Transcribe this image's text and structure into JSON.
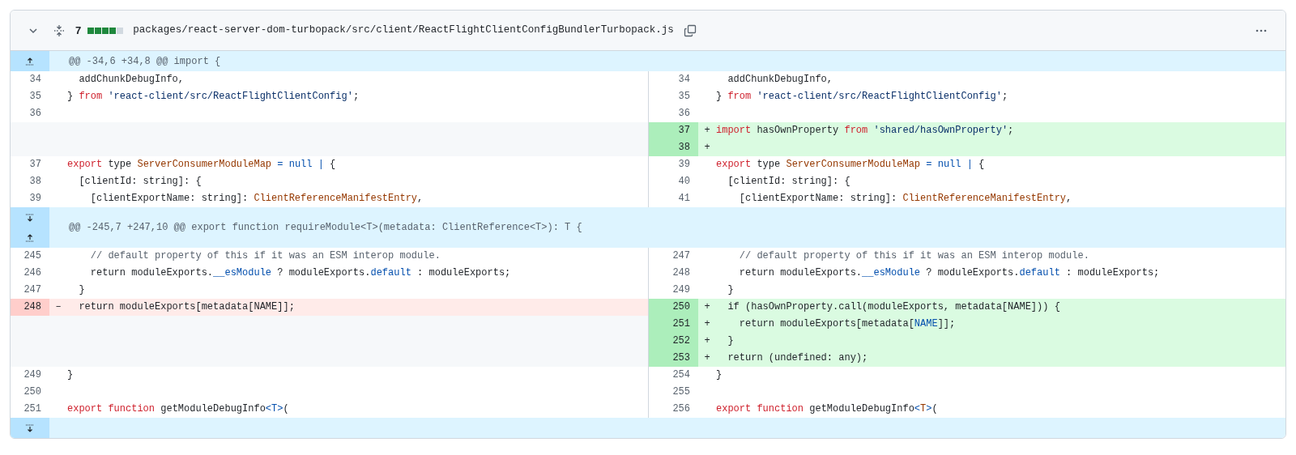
{
  "header": {
    "expanded": true,
    "change_count": "7",
    "diffstat": [
      {
        "kind": "added"
      },
      {
        "kind": "added"
      },
      {
        "kind": "added"
      },
      {
        "kind": "added"
      },
      {
        "kind": "neutral"
      }
    ],
    "path": "packages/react-server-dom-turbopack/src/client/ReactFlightClientConfigBundlerTurbopack.js"
  },
  "rows": [
    {
      "kind": "hunk",
      "expand": [
        {
          "kind": "up"
        }
      ],
      "text": "@@ -34,6 +34,8 @@ import {"
    },
    {
      "kind": "line",
      "left": {
        "num": "34",
        "kind": "context",
        "tokens": [
          {
            "t": "  addChunkDebugInfo,",
            "kind": "plain"
          }
        ]
      },
      "right": {
        "num": "34",
        "kind": "context",
        "tokens": [
          {
            "t": "  addChunkDebugInfo,",
            "kind": "plain"
          }
        ]
      }
    },
    {
      "kind": "line",
      "left": {
        "num": "35",
        "kind": "context",
        "tokens": [
          {
            "t": "} ",
            "kind": "plain"
          },
          {
            "t": "from",
            "kind": "keyword"
          },
          {
            "t": " 'react-client/src/ReactFlightClientConfig'",
            "kind": "string"
          },
          {
            "t": ";",
            "kind": "plain"
          }
        ]
      },
      "right": {
        "num": "35",
        "kind": "context",
        "tokens": [
          {
            "t": "} ",
            "kind": "plain"
          },
          {
            "t": "from",
            "kind": "keyword"
          },
          {
            "t": " 'react-client/src/ReactFlightClientConfig'",
            "kind": "string"
          },
          {
            "t": ";",
            "kind": "plain"
          }
        ]
      }
    },
    {
      "kind": "line",
      "left": {
        "num": "36",
        "kind": "context"
      },
      "right": {
        "num": "36",
        "kind": "context"
      }
    },
    {
      "kind": "line",
      "left": null,
      "right": {
        "num": "37",
        "kind": "add",
        "marker": "+",
        "tokens": [
          {
            "t": "import",
            "kind": "keyword"
          },
          {
            "t": " hasOwnProperty ",
            "kind": "plain"
          },
          {
            "t": "from",
            "kind": "keyword"
          },
          {
            "t": " 'shared/hasOwnProperty'",
            "kind": "string"
          },
          {
            "t": ";",
            "kind": "plain"
          }
        ]
      }
    },
    {
      "kind": "line",
      "left": null,
      "right": {
        "num": "38",
        "kind": "add",
        "marker": "+"
      }
    },
    {
      "kind": "line",
      "left": {
        "num": "37",
        "kind": "context",
        "tokens": [
          {
            "t": "export",
            "kind": "keyword"
          },
          {
            "t": " type ",
            "kind": "plain"
          },
          {
            "t": "ServerConsumerModuleMap",
            "kind": "entity"
          },
          {
            "t": " = null |",
            "kind": "constant"
          },
          {
            "t": " {",
            "kind": "plain"
          }
        ]
      },
      "right": {
        "num": "39",
        "kind": "context",
        "tokens": [
          {
            "t": "export",
            "kind": "keyword"
          },
          {
            "t": " type ",
            "kind": "plain"
          },
          {
            "t": "ServerConsumerModuleMap",
            "kind": "entity"
          },
          {
            "t": " = null |",
            "kind": "constant"
          },
          {
            "t": " {",
            "kind": "plain"
          }
        ]
      }
    },
    {
      "kind": "line",
      "left": {
        "num": "38",
        "kind": "context",
        "tokens": [
          {
            "t": "  [clientId: string]: {",
            "kind": "plain"
          }
        ]
      },
      "right": {
        "num": "40",
        "kind": "context",
        "tokens": [
          {
            "t": "  [clientId: string]: {",
            "kind": "plain"
          }
        ]
      }
    },
    {
      "kind": "line",
      "left": {
        "num": "39",
        "kind": "context",
        "tokens": [
          {
            "t": "    [clientExportName: string]: ",
            "kind": "plain"
          },
          {
            "t": "ClientReferenceManifestEntry",
            "kind": "entity"
          },
          {
            "t": ",",
            "kind": "plain"
          }
        ]
      },
      "right": {
        "num": "41",
        "kind": "context",
        "tokens": [
          {
            "t": "    [clientExportName: string]: ",
            "kind": "plain"
          },
          {
            "t": "ClientReferenceManifestEntry",
            "kind": "entity"
          },
          {
            "t": ",",
            "kind": "plain"
          }
        ]
      }
    },
    {
      "kind": "hunk",
      "expand": [
        {
          "kind": "down"
        },
        {
          "kind": "up"
        }
      ],
      "text": "@@ -245,7 +247,10 @@ export function requireModule<T>(metadata: ClientReference<T>): T {"
    },
    {
      "kind": "line",
      "left": {
        "num": "245",
        "kind": "context",
        "tokens": [
          {
            "t": "    // default property of this if it was an ESM interop module.",
            "kind": "comment"
          }
        ]
      },
      "right": {
        "num": "247",
        "kind": "context",
        "tokens": [
          {
            "t": "    // default property of this if it was an ESM interop module.",
            "kind": "comment"
          }
        ]
      }
    },
    {
      "kind": "line",
      "left": {
        "num": "246",
        "kind": "context",
        "tokens": [
          {
            "t": "    return moduleExports.",
            "kind": "plain"
          },
          {
            "t": "__esModule",
            "kind": "constant"
          },
          {
            "t": " ? moduleExports.",
            "kind": "plain"
          },
          {
            "t": "default",
            "kind": "constant"
          },
          {
            "t": " : moduleExports;",
            "kind": "plain"
          }
        ]
      },
      "right": {
        "num": "248",
        "kind": "context",
        "tokens": [
          {
            "t": "    return moduleExports.",
            "kind": "plain"
          },
          {
            "t": "__esModule",
            "kind": "constant"
          },
          {
            "t": " ? moduleExports.",
            "kind": "plain"
          },
          {
            "t": "default",
            "kind": "constant"
          },
          {
            "t": " : moduleExports;",
            "kind": "plain"
          }
        ]
      }
    },
    {
      "kind": "line",
      "left": {
        "num": "247",
        "kind": "context",
        "tokens": [
          {
            "t": "  }",
            "kind": "plain"
          }
        ]
      },
      "right": {
        "num": "249",
        "kind": "context",
        "tokens": [
          {
            "t": "  }",
            "kind": "plain"
          }
        ]
      }
    },
    {
      "kind": "line",
      "left": {
        "num": "248",
        "kind": "del",
        "marker": "–",
        "tokens": [
          {
            "t": "  return moduleExports[metadata[NAME]];",
            "kind": "plain"
          }
        ]
      },
      "right": {
        "num": "250",
        "kind": "add",
        "marker": "+",
        "tokens": [
          {
            "t": "  if (hasOwnProperty.call(moduleExports, metadata[NAME])) {",
            "kind": "plain"
          }
        ]
      }
    },
    {
      "kind": "line",
      "left": null,
      "right": {
        "num": "251",
        "kind": "add",
        "marker": "+",
        "tokens": [
          {
            "t": "    return moduleExports[metadata[",
            "kind": "plain"
          },
          {
            "t": "NAME",
            "kind": "constant"
          },
          {
            "t": "]];",
            "kind": "plain"
          }
        ]
      }
    },
    {
      "kind": "line",
      "left": null,
      "right": {
        "num": "252",
        "kind": "add",
        "marker": "+",
        "tokens": [
          {
            "t": "  }",
            "kind": "plain"
          }
        ]
      }
    },
    {
      "kind": "line",
      "left": null,
      "right": {
        "num": "253",
        "kind": "add",
        "marker": "+",
        "tokens": [
          {
            "t": "  return (undefined: any);",
            "kind": "plain"
          }
        ]
      }
    },
    {
      "kind": "line",
      "left": {
        "num": "249",
        "kind": "context",
        "tokens": [
          {
            "t": "}",
            "kind": "plain"
          }
        ]
      },
      "right": {
        "num": "254",
        "kind": "context",
        "tokens": [
          {
            "t": "}",
            "kind": "plain"
          }
        ]
      }
    },
    {
      "kind": "line",
      "left": {
        "num": "250",
        "kind": "context"
      },
      "right": {
        "num": "255",
        "kind": "context"
      }
    },
    {
      "kind": "line",
      "left": {
        "num": "251",
        "kind": "context",
        "tokens": [
          {
            "t": "export function",
            "kind": "keyword"
          },
          {
            "t": " getModuleDebugInfo",
            "kind": "plain"
          },
          {
            "t": "<T>",
            "kind": "constant"
          },
          {
            "t": "(",
            "kind": "plain"
          }
        ]
      },
      "right": {
        "num": "256",
        "kind": "context",
        "tokens": [
          {
            "t": "export function",
            "kind": "keyword"
          },
          {
            "t": " getModuleDebugInfo",
            "kind": "plain"
          },
          {
            "t": "<",
            "kind": "constant"
          },
          {
            "t": "T",
            "kind": "entity"
          },
          {
            "t": ">",
            "kind": "constant"
          },
          {
            "t": "(",
            "kind": "plain"
          }
        ]
      }
    },
    {
      "kind": "hunk",
      "expand": [
        {
          "kind": "down"
        }
      ]
    }
  ]
}
